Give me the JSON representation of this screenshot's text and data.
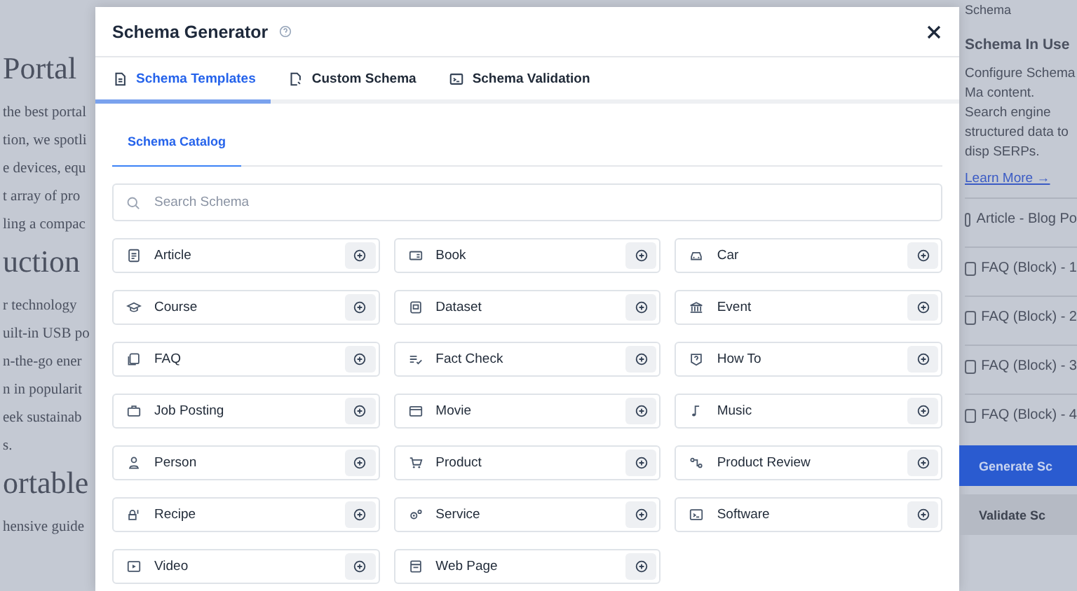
{
  "background_page": {
    "lines": [
      {
        "text": "Portal",
        "kind": "heading"
      },
      {
        "text": "the best portal",
        "kind": "text"
      },
      {
        "text": "tion, we spotli",
        "kind": "text"
      },
      {
        "text": "e devices, equ",
        "kind": "text"
      },
      {
        "text": "t array of pro",
        "kind": "text"
      },
      {
        "text": "ling a compac",
        "kind": "text"
      },
      {
        "text": "uction",
        "kind": "heading"
      },
      {
        "text": "r technology",
        "kind": "text"
      },
      {
        "text": "uilt-in USB po",
        "kind": "text"
      },
      {
        "text": "n-the-go ener",
        "kind": "text"
      },
      {
        "text": "n in popularit",
        "kind": "text"
      },
      {
        "text": "eek sustainab",
        "kind": "text"
      },
      {
        "text": "s.",
        "kind": "text"
      },
      {
        "text": "ortable",
        "kind": "heading"
      },
      {
        "text": "hensive guide",
        "kind": "text"
      }
    ]
  },
  "sidebar": {
    "breadcrumb": "Schema",
    "title": "Schema In Use",
    "description": "Configure Schema Ma content. Search engine structured data to disp SERPs.",
    "link": "Learn More →",
    "items": [
      {
        "label": "Article - Blog Po"
      },
      {
        "label": "FAQ (Block) - 1"
      },
      {
        "label": "FAQ (Block) - 2"
      },
      {
        "label": "FAQ (Block) - 3"
      },
      {
        "label": "FAQ (Block) - 4"
      }
    ],
    "buttons": [
      {
        "label": "Generate Sc",
        "kind": "primary"
      },
      {
        "label": "Validate Sc",
        "kind": "secondary"
      }
    ]
  },
  "modal": {
    "title": "Schema Generator",
    "tabs": [
      {
        "label": "Schema Templates",
        "selected": true
      },
      {
        "label": "Custom Schema",
        "selected": false
      },
      {
        "label": "Schema Validation",
        "selected": false
      }
    ],
    "subtabs": [
      {
        "label": "Schema Catalog",
        "selected": true
      }
    ],
    "search": {
      "placeholder": "Search Schema"
    },
    "items": [
      {
        "label": "Article"
      },
      {
        "label": "Book"
      },
      {
        "label": "Car"
      },
      {
        "label": "Course"
      },
      {
        "label": "Dataset"
      },
      {
        "label": "Event"
      },
      {
        "label": "FAQ"
      },
      {
        "label": "Fact Check"
      },
      {
        "label": "How To"
      },
      {
        "label": "Job Posting"
      },
      {
        "label": "Movie"
      },
      {
        "label": "Music"
      },
      {
        "label": "Person"
      },
      {
        "label": "Product"
      },
      {
        "label": "Product Review"
      },
      {
        "label": "Recipe"
      },
      {
        "label": "Service"
      },
      {
        "label": "Software"
      },
      {
        "label": "Video"
      },
      {
        "label": "Web Page"
      }
    ]
  }
}
